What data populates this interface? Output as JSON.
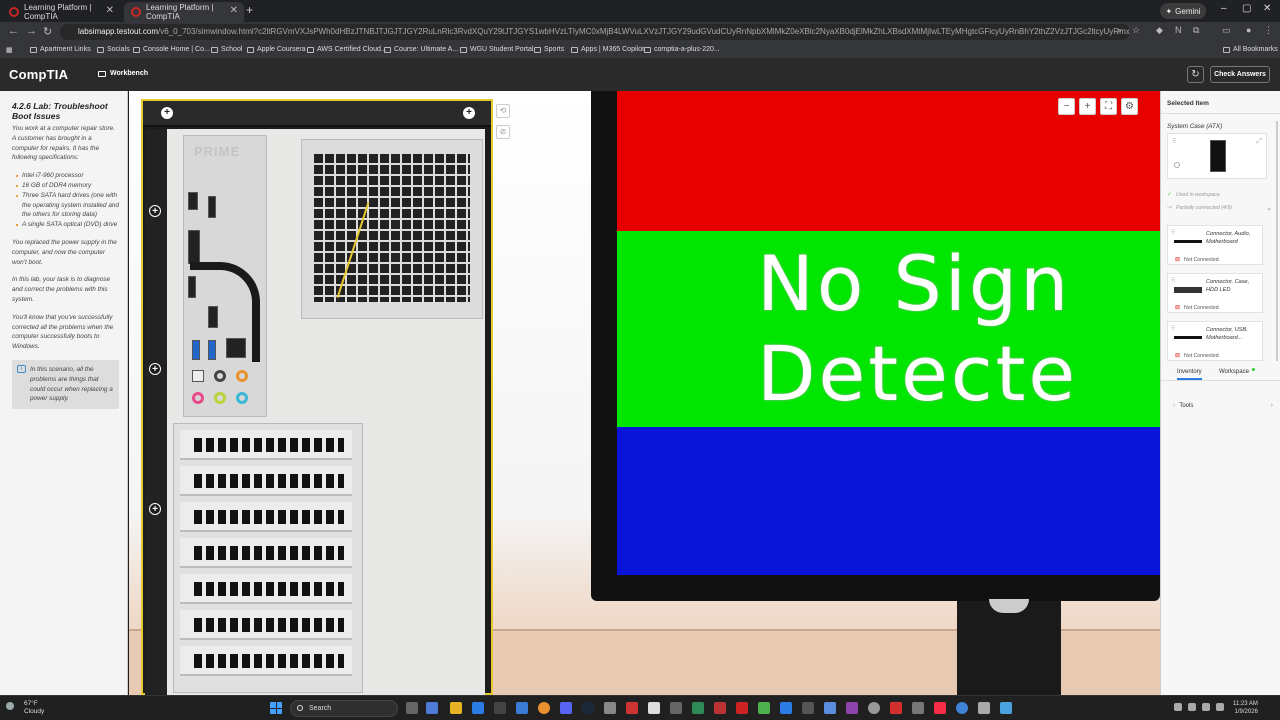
{
  "browser": {
    "tabs": [
      {
        "label": "Learning Platform | CompTIA",
        "active": false
      },
      {
        "label": "Learning Platform | CompTIA",
        "active": true
      }
    ],
    "gemini_label": "Gemini",
    "url_host": "labsimapp.testout.com",
    "url_path": "/v6_0_703/simwindow.html?c2ltRGVmVXJsPWh0dHBzJTNBJTJGJTJGY2RuLnRlc3RvdXQuY29tJTJGYS1wbHVzLTIyMC0xMjB4LWVuLXVzJTJGY29udGVudCUyRnNpbXMlMkZ0eXBlc2NyaXB0djElMkZhLXBsdXMtMjIwLTEyMHgtcGFicyUyRnBhY2thZ2VzJTJGc2ltcyUyRmxldHJvdWJsZXNob290X2Jvb3RfaXNzdWVzLmpzJnJlc",
    "bookmarks": [
      "Apartment Links",
      "Socials",
      "Console Home | Co...",
      "School",
      "Apple Coursera",
      "AWS Certified Cloud...",
      "Course: Ultimate A...",
      "WGU Student Portal",
      "Sports",
      "Apps | M365 Copilot",
      "comptia-a-plus-220..."
    ],
    "all_bookmarks": "All Bookmarks"
  },
  "app": {
    "logo": "CompTIA",
    "workbench_label": "Workbench",
    "check_answers_label": "Check Answers",
    "refresh_icon": "refresh-icon"
  },
  "instructions": {
    "title": "4.2.6 Lab: Troubleshoot Boot Issues",
    "intro": "You work at a computer repair store. A customer has brought in a computer for repairs. It has the following specifications:",
    "specs": [
      "Intel i7-960 processor",
      "16 GB of DDR4 memory",
      "Three SATA hard drives (one with the operating system installed and the others for storing data)",
      "A single SATA optical (DVD) drive"
    ],
    "para2": "You replaced the power supply in the computer, and now the computer won't boot.",
    "para3": "In this lab, your task is to diagnose and correct the problems with this system.",
    "para4": "You'll know that you've successfully corrected all the problems when the computer successfully boots to Windows.",
    "note": "In this scenario, all the problems are things that could occur when replacing a power supply."
  },
  "workspace": {
    "case_brand": "PRIME",
    "monitor_text_line1": "No Sign",
    "monitor_text_line2": "Detecte",
    "monitor_colors": {
      "top": "#e60000",
      "middle": "#00e600",
      "bottom": "#0a14d9"
    }
  },
  "selected_panel": {
    "header": "Selected Item",
    "item_name": "System Case (ATX)",
    "used_in_workspace": "Used in workspace",
    "partially_connected": "Partially connected (4/9)",
    "connectors": [
      {
        "name": "Connector, Audio, Motherboard",
        "status": "Not Connected"
      },
      {
        "name": "Connector, Case, HDD LED",
        "status": "Not Connected"
      },
      {
        "name": "Connector, USB, Motherboard...",
        "status": "Not Connected"
      }
    ],
    "tabs": {
      "inventory": "Inventory",
      "workspace": "Workspace"
    },
    "tools_label": "Tools"
  },
  "taskbar": {
    "weather_temp": "67°F",
    "weather_desc": "Cloudy",
    "search_placeholder": "Search",
    "time": "11:23 AM",
    "date": "1/9/2026"
  }
}
